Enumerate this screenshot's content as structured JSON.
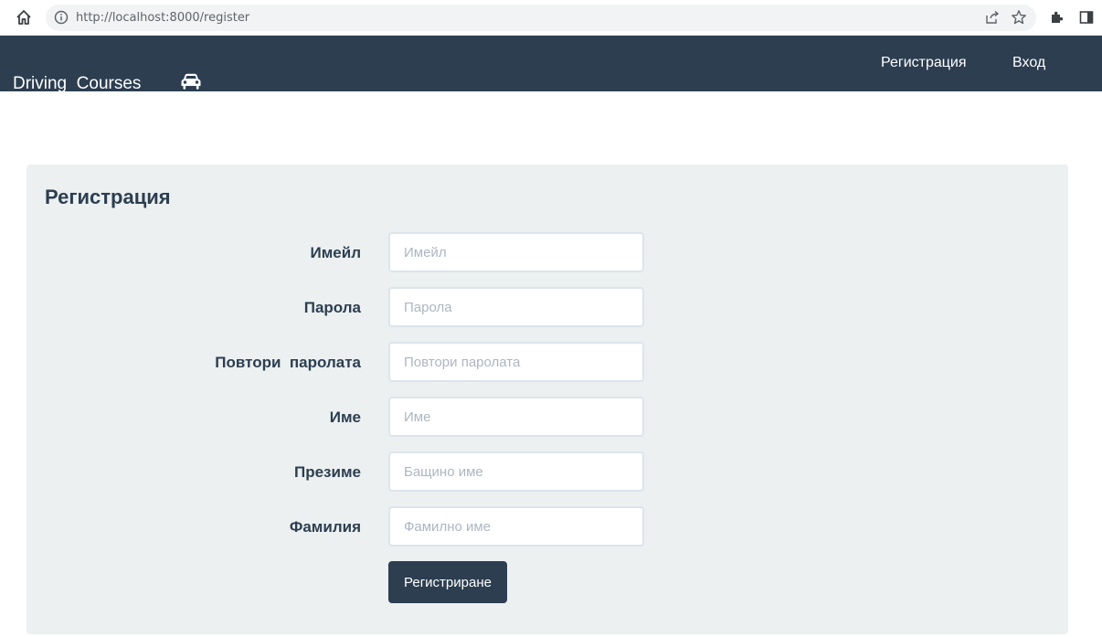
{
  "browser": {
    "url": "http://localhost:8000/register"
  },
  "navbar": {
    "brand_text": "Driving  Courses",
    "links": {
      "register": "Регистрация",
      "login": "Вход"
    }
  },
  "form": {
    "title": "Регистрация",
    "fields": [
      {
        "label": "Имейл",
        "placeholder": "Имейл"
      },
      {
        "label": "Парола",
        "placeholder": "Парола"
      },
      {
        "label": "Повтори  паролата",
        "placeholder": "Повтори паролата"
      },
      {
        "label": "Име",
        "placeholder": "Име"
      },
      {
        "label": "Презиме",
        "placeholder": "Бащино име"
      },
      {
        "label": "Фамилия",
        "placeholder": "Фамилно име"
      }
    ],
    "submit_label": "Регистриране"
  },
  "colors": {
    "navbar": "#2c3e50",
    "card": "#ecf0f1",
    "text": "#2c3e50",
    "input_border": "#dce4ec"
  },
  "icons": {
    "brand": "car-icon",
    "home": "home-icon",
    "info": "info-icon",
    "share": "share-icon",
    "bookmark": "star-icon",
    "extensions": "puzzle-icon",
    "side_panel": "side-panel-icon"
  }
}
